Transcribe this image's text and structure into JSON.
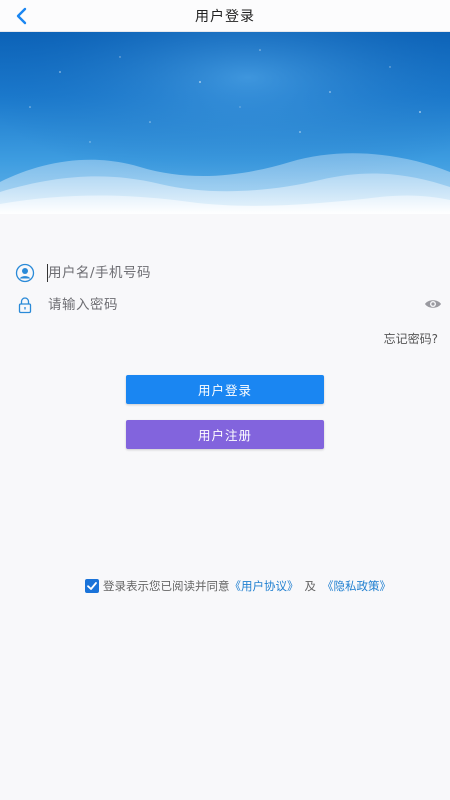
{
  "header": {
    "title": "用户登录",
    "back_icon": "chevron-left-icon"
  },
  "form": {
    "username": {
      "placeholder": "用户名/手机号码",
      "value": "",
      "icon": "user-icon"
    },
    "password": {
      "placeholder": "请输入密码",
      "value": "",
      "icon": "lock-icon",
      "toggle_icon": "eye-icon"
    },
    "forgot_label": "忘记密码?"
  },
  "buttons": {
    "login_label": "用户登录",
    "register_label": "用户注册"
  },
  "agreement": {
    "checked": true,
    "prefix": "登录表示您已阅读并同意",
    "user_agreement": "《用户协议》",
    "conjunction": "及",
    "privacy_policy": "《隐私政策》"
  },
  "colors": {
    "accent": "#1a86f2",
    "register": "#8264dd",
    "link": "#1f7fd0",
    "icon": "#2a8ad8"
  }
}
